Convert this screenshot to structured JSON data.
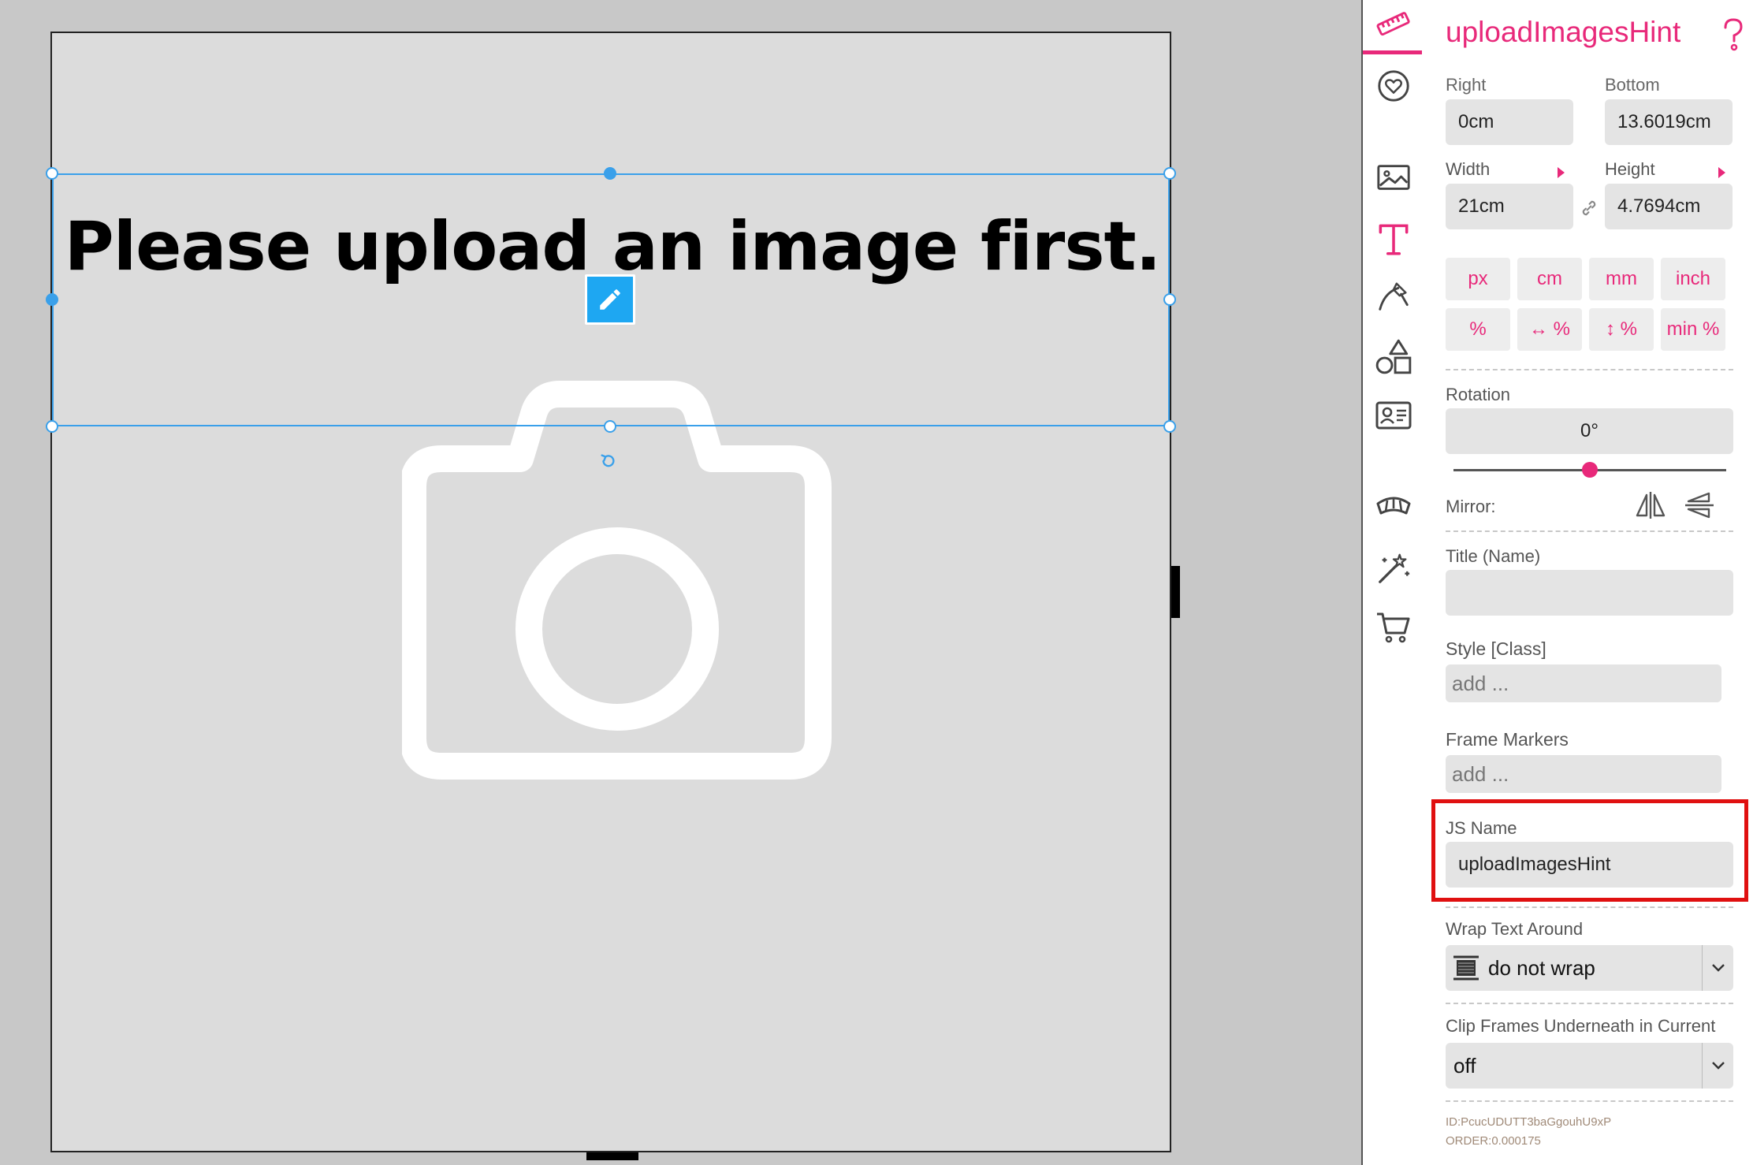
{
  "canvas": {
    "headline": "Please upload an image first."
  },
  "toolbar": {
    "tools": [
      "ruler-icon",
      "heart-badge-icon",
      "image-icon",
      "text-icon",
      "pen-icon",
      "shapes-icon",
      "contact-card-icon",
      "bridge-icon",
      "magic-wand-icon",
      "cart-icon"
    ],
    "active_tool": "ruler-icon"
  },
  "panel": {
    "title": "uploadImagesHint",
    "right_label": "Right",
    "right_value": "0cm",
    "bottom_label": "Bottom",
    "bottom_value": "13.6019cm",
    "width_label": "Width",
    "width_value": "21cm",
    "height_label": "Height",
    "height_value": "4.7694cm",
    "units_row1": [
      "px",
      "cm",
      "mm",
      "inch"
    ],
    "units_row2": [
      "%",
      "↔ %",
      "↕ %",
      "min %"
    ],
    "rotation_label": "Rotation",
    "rotation_value": "0°",
    "rotation_slider_fraction": 0.5,
    "mirror_label": "Mirror:",
    "title_name_label": "Title (Name)",
    "title_name_value": "",
    "style_label": "Style [Class]",
    "style_placeholder": "add ...",
    "frame_markers_label": "Frame Markers",
    "frame_markers_placeholder": "add ...",
    "js_name_label": "JS Name",
    "js_name_value": "uploadImagesHint",
    "wrap_label": "Wrap Text Around",
    "wrap_value": "do not wrap",
    "clip_label": "Clip Frames Underneath in Current",
    "clip_value": "off",
    "id_text": "ID:PcucUDUTT3baGgouhU9xP",
    "order_text": "ORDER:0.000175"
  },
  "colors": {
    "accent": "#e8297a",
    "selection": "#3aa0ea",
    "highlight": "#e01010"
  }
}
